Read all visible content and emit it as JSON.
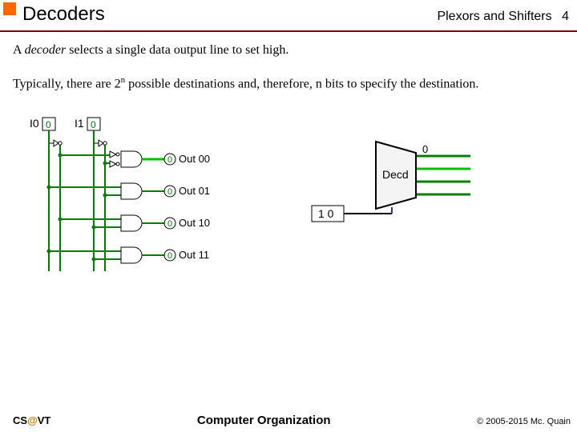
{
  "header": {
    "title": "Decoders",
    "chapter": "Plexors and Shifters",
    "page": "4"
  },
  "body": {
    "line1_prefix": "A ",
    "line1_em": "decoder",
    "line1_rest": " selects a single data output line to set high.",
    "line2_pre": "Typically, there are 2",
    "line2_sup": "n",
    "line2_post": " possible destinations and, therefore, n bits to specify the destination."
  },
  "diagram": {
    "in0": "I0",
    "in1": "I1",
    "zero": "0",
    "outs": [
      "Out 00",
      "Out 01",
      "Out 10",
      "Out 11"
    ],
    "block_label": "Decd",
    "sel": "1 0"
  },
  "footer": {
    "left_pre": "CS",
    "left_at": "@",
    "left_post": "VT",
    "center": "Computer Organization",
    "right": "© 2005-2015 Mc. Quain"
  }
}
